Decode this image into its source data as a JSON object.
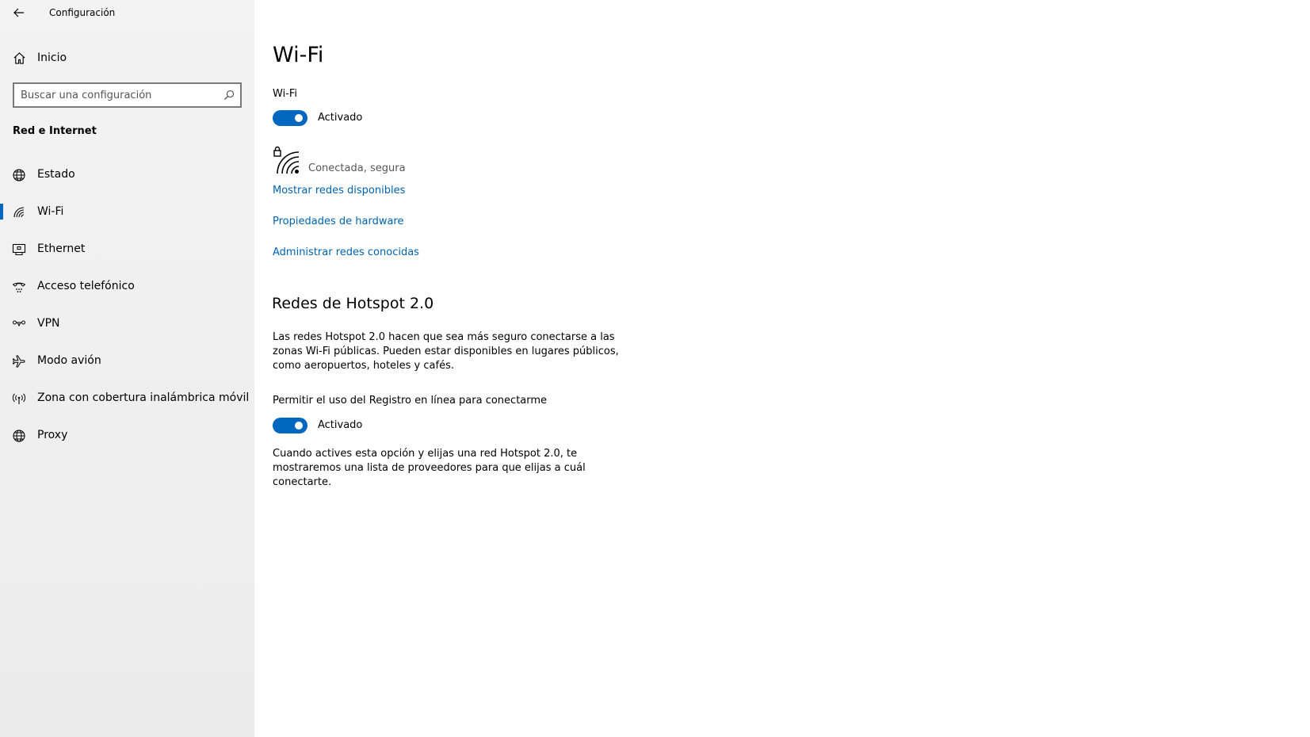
{
  "window": {
    "title": "Configuración"
  },
  "sidebar": {
    "home_label": "Inicio",
    "search": {
      "placeholder": "Buscar una configuración",
      "value": ""
    },
    "section_title": "Red e Internet",
    "items": [
      {
        "label": "Estado",
        "icon": "globe-status-icon"
      },
      {
        "label": "Wi-Fi",
        "icon": "wifi-icon",
        "active": true
      },
      {
        "label": "Ethernet",
        "icon": "ethernet-icon"
      },
      {
        "label": "Acceso telefónico",
        "icon": "dialup-icon"
      },
      {
        "label": "VPN",
        "icon": "vpn-icon"
      },
      {
        "label": "Modo avión",
        "icon": "airplane-icon"
      },
      {
        "label": "Zona con cobertura inalámbrica móvil",
        "icon": "mobile-hotspot-icon"
      },
      {
        "label": "Proxy",
        "icon": "globe-icon"
      }
    ]
  },
  "main": {
    "title": "Wi-Fi",
    "wifi_toggle": {
      "label": "Wi-Fi",
      "state_label": "Activado",
      "on": true
    },
    "network": {
      "status": "Conectada, segura",
      "icon": "wifi-secure-icon"
    },
    "links": {
      "show_networks": "Mostrar redes disponibles",
      "hardware_props": "Propiedades de hardware",
      "manage_known": "Administrar redes conocidas"
    },
    "hotspot": {
      "heading": "Redes de Hotspot 2.0",
      "description": "Las redes Hotspot 2.0 hacen que sea más seguro conectarse a las zonas Wi-Fi públicas. Pueden estar disponibles en lugares públicos, como aeropuertos, hoteles y cafés.",
      "permission_label": "Permitir el uso del Registro en línea para conectarme",
      "permission_state_label": "Activado",
      "permission_on": true,
      "note": "Cuando actives esta opción y elijas una red Hotspot 2.0, te mostraremos una lista de proveedores para que elijas a cuál conectarte."
    }
  },
  "colors": {
    "accent": "#0067c0",
    "link": "#0063b1",
    "sidebar_bg": "#f2f2f2"
  }
}
